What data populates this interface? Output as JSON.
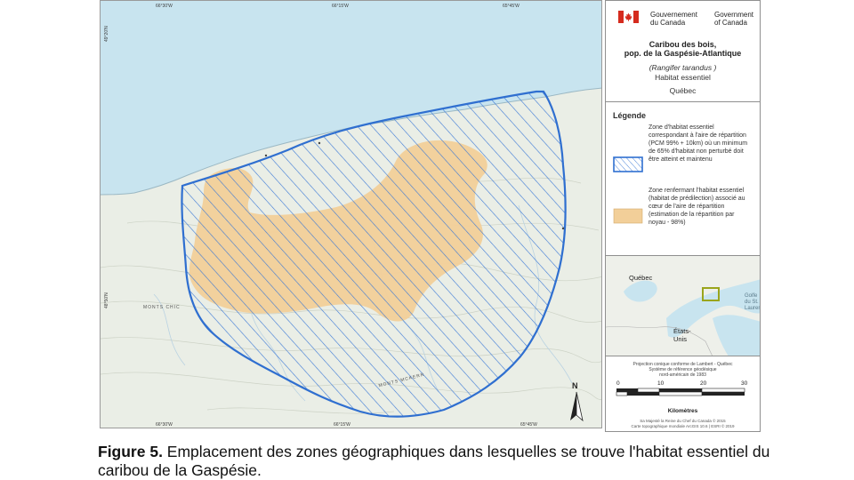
{
  "map": {
    "coords": {
      "top_1": "66°30'W",
      "top_2": "66°15'W",
      "top_3": "65°45'W",
      "left_1": "49°20'N",
      "left_2": "48°50'N",
      "bottom_1": "66°30'W",
      "bottom_2": "66°15'W",
      "bottom_3": "65°45'W"
    },
    "places": {
      "monts_chic": "MONTS CHIC",
      "monts_mckerr": "MONTS MCKERR"
    },
    "north_letter": "N"
  },
  "panel": {
    "gov_en": [
      "Government",
      "of Canada"
    ],
    "gov_fr": [
      "Gouvernement",
      "du Canada"
    ],
    "title_1": "Caribou des bois,",
    "title_2": "pop. de la Gaspésie-Atlantique",
    "species": "(Rangifer tarandus )",
    "habitat": "Habitat essentiel",
    "province": "Québec",
    "legend": {
      "title": "Légende",
      "item_1": "Zone d'habitat essentiel correspondant à l'aire de répartition (PCM 99% + 10km) où un minimum de 65% d'habitat non perturbé doit être atteint et maintenu",
      "item_2": "Zone renfermant l'habitat essentiel (habitat de prédilection) associé au cœur de l'aire de répartition (estimation de la répartition par noyau - 98%)"
    },
    "inset": {
      "quebec": "Québec",
      "usa_1": "États-",
      "usa_2": "Unis",
      "gulf": "Golfe du St. Laurent"
    },
    "projection": [
      "Projection conique conforme de Lambert - Québec",
      "Système de référence géodésique",
      "nord-américain de 1983"
    ],
    "scale": {
      "ticks": [
        "0",
        "10",
        "20",
        "30"
      ],
      "unit": "Kilomètres"
    },
    "copyright": [
      "Sa Majesté la Reine du Chef du Canada © 2015",
      "Carte topographique mondiale ArcGIS 10.6 | ESRI © 2019"
    ]
  },
  "caption": {
    "label": "Figure 5.",
    "text": " Emplacement des zones géographiques dans lesquelles se trouve l'habitat essentiel du caribou de la Gaspésie."
  },
  "colors": {
    "water": "#c8e4ef",
    "land": "#eaeee6",
    "hatch_border": "#2f6fd0",
    "core_fill": "#f2cf99",
    "flag_red": "#d52b1e",
    "inset_box": "#9aa51c"
  }
}
